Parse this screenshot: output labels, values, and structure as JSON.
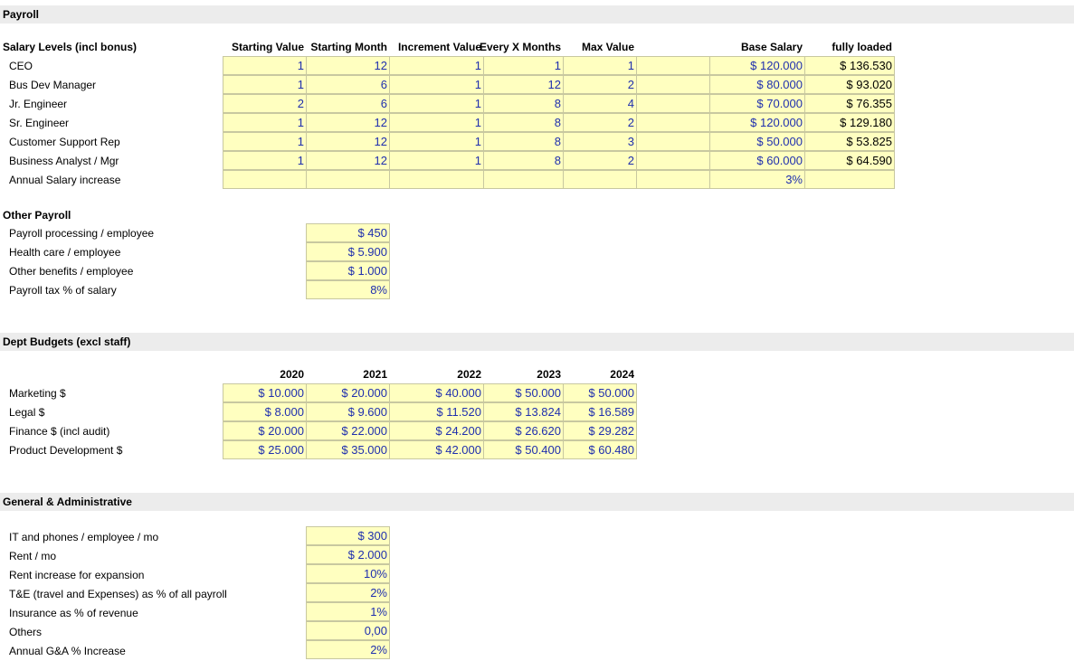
{
  "sections": {
    "payroll": "Payroll",
    "dept": "Dept Budgets (excl staff)",
    "ga": "General & Administrative"
  },
  "salary": {
    "title": "Salary Levels (incl bonus)",
    "headers": [
      "Starting Value",
      "Starting Month",
      "Increment Value",
      "Every X Months",
      "Max Value",
      "Base Salary",
      "fully loaded"
    ],
    "rows": [
      {
        "label": "CEO",
        "start": "1",
        "month": "12",
        "inc": "1",
        "every": "1",
        "max": "1",
        "base": "$ 120.000",
        "loaded": "$ 136.530"
      },
      {
        "label": "Bus Dev Manager",
        "start": "1",
        "month": "6",
        "inc": "1",
        "every": "12",
        "max": "2",
        "base": "$ 80.000",
        "loaded": "$ 93.020"
      },
      {
        "label": "Jr. Engineer",
        "start": "2",
        "month": "6",
        "inc": "1",
        "every": "8",
        "max": "4",
        "base": "$ 70.000",
        "loaded": "$ 76.355"
      },
      {
        "label": "Sr. Engineer",
        "start": "1",
        "month": "12",
        "inc": "1",
        "every": "8",
        "max": "2",
        "base": "$ 120.000",
        "loaded": "$ 129.180"
      },
      {
        "label": "Customer Support Rep",
        "start": "1",
        "month": "12",
        "inc": "1",
        "every": "8",
        "max": "3",
        "base": "$ 50.000",
        "loaded": "$ 53.825"
      },
      {
        "label": "Business Analyst / Mgr",
        "start": "1",
        "month": "12",
        "inc": "1",
        "every": "8",
        "max": "2",
        "base": "$ 60.000",
        "loaded": "$ 64.590"
      }
    ],
    "annual_label": "Annual Salary increase",
    "annual_value": "3%"
  },
  "other_payroll": {
    "title": "Other Payroll",
    "rows": [
      {
        "label": "Payroll processing / employee",
        "value": "$ 450"
      },
      {
        "label": "Health care / employee",
        "value": "$ 5.900"
      },
      {
        "label": "Other benefits / employee",
        "value": "$ 1.000"
      },
      {
        "label": "Payroll tax % of salary",
        "value": "8%"
      }
    ]
  },
  "dept": {
    "years": [
      "2020",
      "2021",
      "2022",
      "2023",
      "2024"
    ],
    "rows": [
      {
        "label": "Marketing $",
        "values": [
          "$ 10.000",
          "$ 20.000",
          "$ 40.000",
          "$ 50.000",
          "$ 50.000"
        ]
      },
      {
        "label": "Legal $",
        "values": [
          "$ 8.000",
          "$ 9.600",
          "$ 11.520",
          "$ 13.824",
          "$ 16.589"
        ]
      },
      {
        "label": "Finance $ (incl audit)",
        "values": [
          "$ 20.000",
          "$ 22.000",
          "$ 24.200",
          "$ 26.620",
          "$ 29.282"
        ]
      },
      {
        "label": "Product Development $",
        "values": [
          "$ 25.000",
          "$ 35.000",
          "$ 42.000",
          "$ 50.400",
          "$ 60.480"
        ]
      }
    ]
  },
  "ga": {
    "rows": [
      {
        "label": "IT and phones / employee / mo",
        "value": "$ 300"
      },
      {
        "label": "Rent / mo",
        "value": "$ 2.000"
      },
      {
        "label": "Rent increase for expansion",
        "value": "10%"
      },
      {
        "label": "T&E (travel and Expenses) as % of all payroll",
        "value": "2%"
      },
      {
        "label": "Insurance as % of revenue",
        "value": "1%"
      },
      {
        "label": "Others",
        "value": "0,00"
      },
      {
        "label": "Annual G&A % Increase",
        "value": "2%"
      }
    ]
  }
}
